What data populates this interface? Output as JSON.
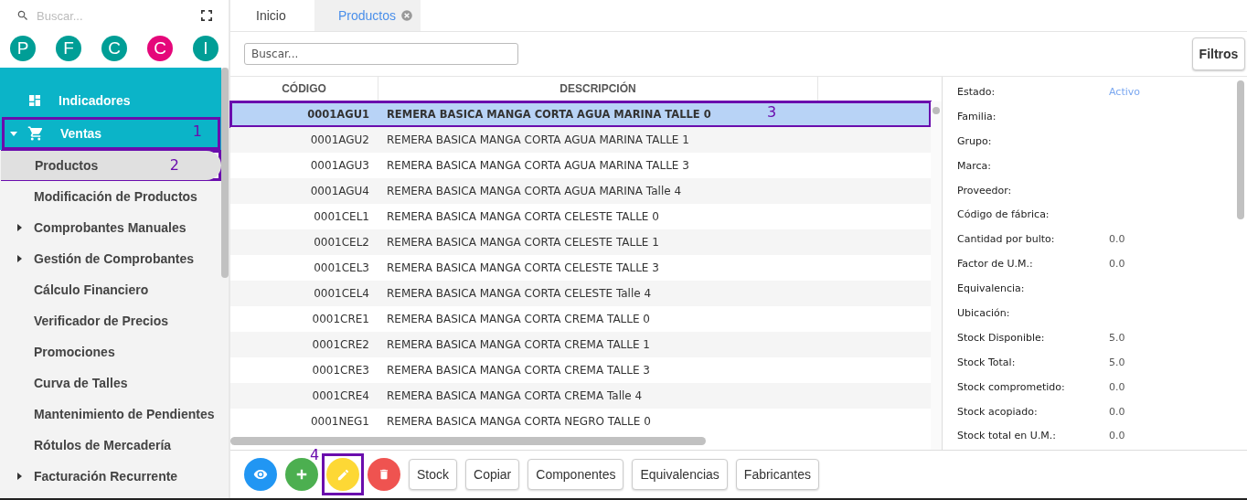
{
  "sidebar": {
    "search": {
      "placeholder": "Buscar..."
    },
    "avatars": [
      {
        "letter": "P",
        "color": "#009e96"
      },
      {
        "letter": "F",
        "color": "#009e96"
      },
      {
        "letter": "C",
        "color": "#009e96"
      },
      {
        "letter": "C",
        "color": "#e5077a"
      },
      {
        "letter": "I",
        "color": "#009e96"
      }
    ],
    "modules": [
      {
        "label": "Indicadores",
        "expandable": false
      },
      {
        "label": "Ventas",
        "expandable": true,
        "expanded": true,
        "callout": "1"
      }
    ],
    "items": [
      {
        "label": "Productos",
        "expandable": false,
        "selected": true,
        "callout": "2"
      },
      {
        "label": "Modificación de Productos",
        "expandable": false,
        "selected": false
      },
      {
        "label": "Comprobantes Manuales",
        "expandable": true,
        "selected": false
      },
      {
        "label": "Gestión de Comprobantes",
        "expandable": true,
        "selected": false
      },
      {
        "label": "Cálculo Financiero",
        "expandable": false,
        "selected": false
      },
      {
        "label": "Verificador de Precios",
        "expandable": false,
        "selected": false
      },
      {
        "label": "Promociones",
        "expandable": false,
        "selected": false
      },
      {
        "label": "Curva de Talles",
        "expandable": false,
        "selected": false
      },
      {
        "label": "Mantenimiento de Pendientes",
        "expandable": false,
        "selected": false
      },
      {
        "label": "Rótulos de Mercadería",
        "expandable": false,
        "selected": false
      },
      {
        "label": "Facturación Recurrente",
        "expandable": true,
        "selected": false
      }
    ]
  },
  "tabs": [
    {
      "label": "Inicio",
      "selected": false,
      "closable": false
    },
    {
      "label": "Productos",
      "selected": true,
      "closable": true
    }
  ],
  "search": {
    "placeholder": "Buscar..."
  },
  "filter_button": "Filtros",
  "table": {
    "columns": [
      "CÓDIGO",
      "DESCRIPCIÓN"
    ],
    "rows": [
      {
        "code": "0001AGU1",
        "description": "REMERA BASICA MANGA CORTA AGUA MARINA TALLE 0",
        "selected": true,
        "callout": "3"
      },
      {
        "code": "0001AGU2",
        "description": "REMERA BASICA MANGA CORTA AGUA MARINA TALLE 1",
        "selected": false
      },
      {
        "code": "0001AGU3",
        "description": "REMERA BASICA MANGA CORTA AGUA MARINA TALLE 3",
        "selected": false
      },
      {
        "code": "0001AGU4",
        "description": "REMERA BASICA MANGA CORTA AGUA MARINA Talle 4",
        "selected": false
      },
      {
        "code": "0001CEL1",
        "description": "REMERA BASICA MANGA CORTA CELESTE TALLE 0",
        "selected": false
      },
      {
        "code": "0001CEL2",
        "description": "REMERA BASICA MANGA CORTA CELESTE TALLE 1",
        "selected": false
      },
      {
        "code": "0001CEL3",
        "description": "REMERA BASICA MANGA CORTA CELESTE TALLE 3",
        "selected": false
      },
      {
        "code": "0001CEL4",
        "description": "REMERA BASICA MANGA CORTA CELESTE Talle 4",
        "selected": false
      },
      {
        "code": "0001CRE1",
        "description": "REMERA BASICA MANGA CORTA CREMA TALLE 0",
        "selected": false
      },
      {
        "code": "0001CRE2",
        "description": "REMERA BASICA MANGA CORTA CREMA TALLE 1",
        "selected": false
      },
      {
        "code": "0001CRE3",
        "description": "REMERA BASICA MANGA CORTA CREMA TALLE 3",
        "selected": false
      },
      {
        "code": "0001CRE4",
        "description": "REMERA BASICA MANGA CORTA CREMA Talle 4",
        "selected": false
      },
      {
        "code": "0001NEG1",
        "description": "REMERA BASICA MANGA CORTA NEGRO TALLE 0",
        "selected": false
      }
    ]
  },
  "status": {
    "label": "Estado:",
    "value": "Activo"
  },
  "details": [
    {
      "label": "Familia:"
    },
    {
      "label": "Grupo:"
    },
    {
      "label": "Marca:"
    },
    {
      "label": "Proveedor:"
    },
    {
      "label": "Código de fábrica:"
    },
    {
      "label": "Cantidad por bulto:",
      "value": "0.0"
    },
    {
      "label": "Factor de U.M.:",
      "value": "0.0"
    },
    {
      "label": "Equivalencia:"
    },
    {
      "label": "Ubicación:"
    },
    {
      "label": "Stock Disponible:",
      "value": "5.0"
    },
    {
      "label": "Stock Total:",
      "value": "5.0"
    },
    {
      "label": "Stock comprometido:",
      "value": "0.0"
    },
    {
      "label": "Stock acopiado:",
      "value": "0.0"
    },
    {
      "label": "Stock total en U.M.:",
      "value": "0.0"
    }
  ],
  "actions": [
    {
      "kind": "view"
    },
    {
      "kind": "add"
    },
    {
      "kind": "edit",
      "callout": "4"
    },
    {
      "kind": "delete"
    }
  ],
  "buttons": [
    "Stock",
    "Copiar",
    "Componentes",
    "Equivalencias",
    "Fabricantes"
  ]
}
